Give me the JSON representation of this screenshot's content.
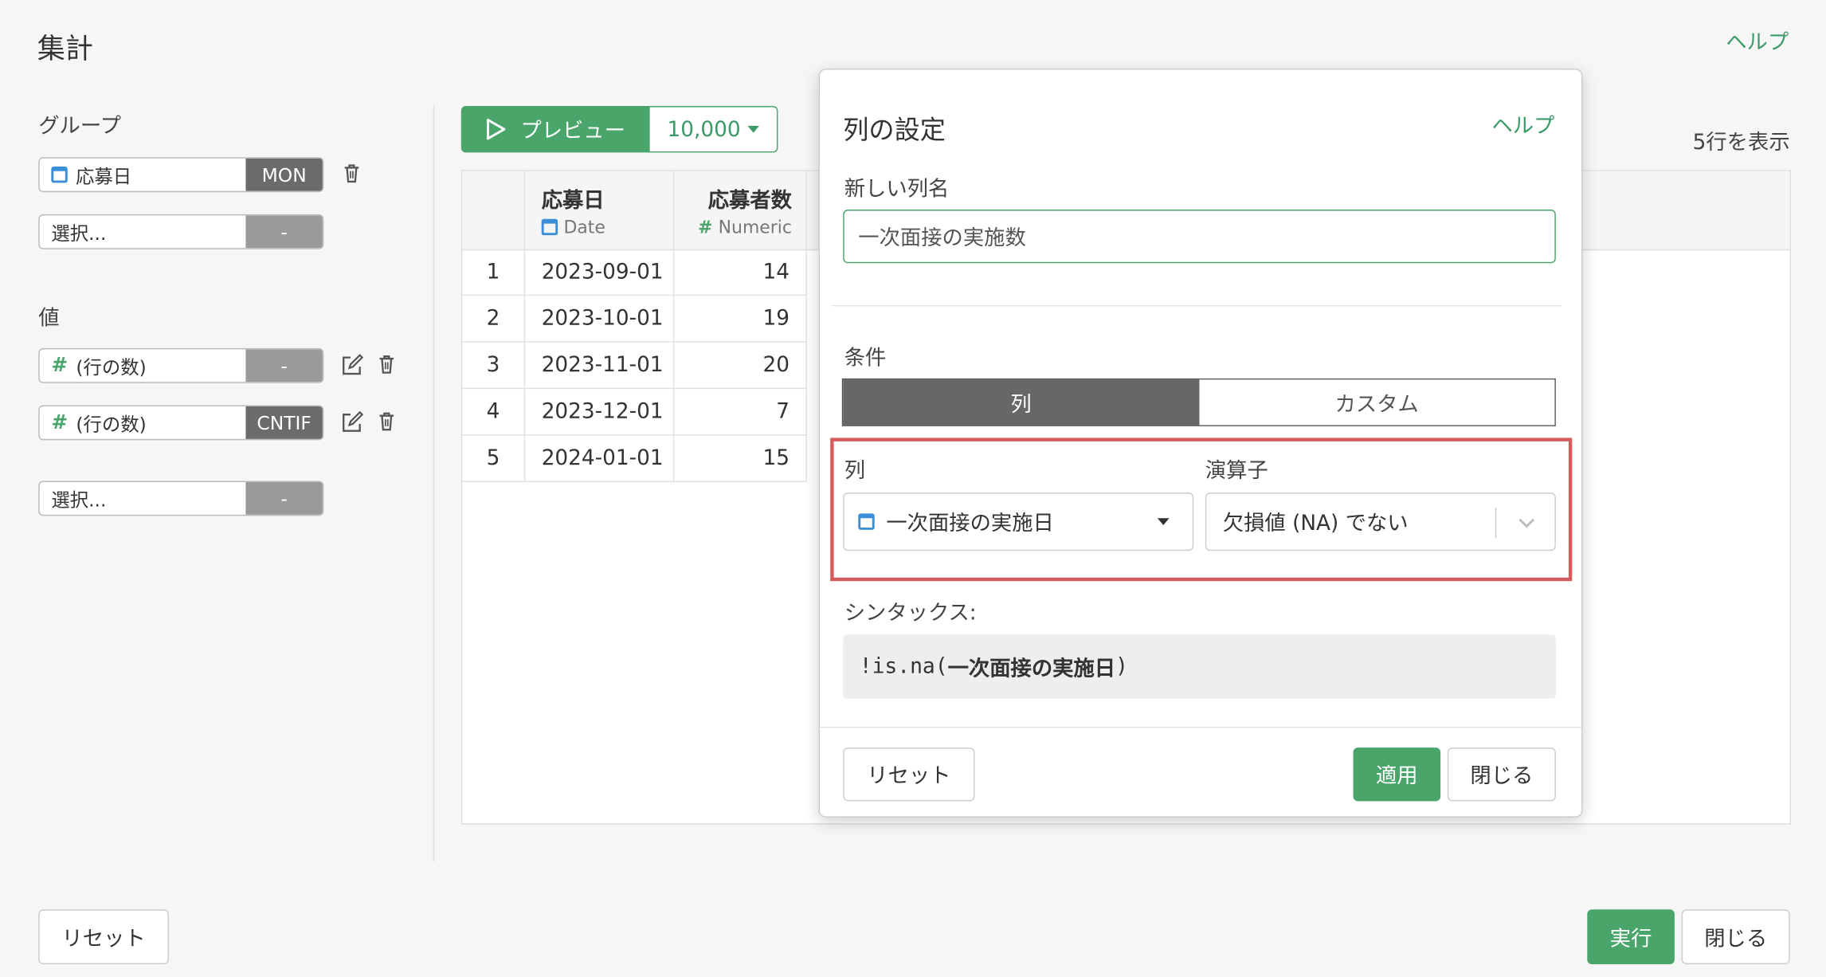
{
  "page": {
    "title": "集計",
    "help": "ヘルプ"
  },
  "group": {
    "label": "グループ",
    "fields": [
      {
        "name": "応募日",
        "type_icon": "calendar-icon",
        "func": "MON"
      },
      {
        "name": "選択...",
        "func": "-"
      }
    ]
  },
  "values": {
    "label": "値",
    "fields": [
      {
        "hash": "#",
        "name": "(行の数)",
        "func": "-"
      },
      {
        "hash": "#",
        "name": "(行の数)",
        "func": "CNTIF"
      },
      {
        "name": "選択...",
        "func": "-"
      }
    ]
  },
  "toolbar": {
    "preview_label": "プレビュー",
    "row_limit": "10,000",
    "row_count_text": "5行を表示"
  },
  "table": {
    "columns": [
      {
        "name": "応募日",
        "type": "Date",
        "type_icon": "calendar-icon"
      },
      {
        "name": "応募者数",
        "type": "Numeric",
        "type_icon": "hash-icon",
        "type_symbol": "#"
      }
    ],
    "rows": [
      {
        "idx": "1",
        "date": "2023-09-01",
        "count": "14"
      },
      {
        "idx": "2",
        "date": "2023-10-01",
        "count": "19"
      },
      {
        "idx": "3",
        "date": "2023-11-01",
        "count": "20"
      },
      {
        "idx": "4",
        "date": "2023-12-01",
        "count": "7"
      },
      {
        "idx": "5",
        "date": "2024-01-01",
        "count": "15"
      }
    ]
  },
  "dialog": {
    "title": "列の設定",
    "help": "ヘルプ",
    "new_name_label": "新しい列名",
    "new_name_value": "一次面接の実施数",
    "condition_label": "条件",
    "tabs": [
      "列",
      "カスタム"
    ],
    "column_label": "列",
    "column_value": "一次面接の実施日",
    "operator_label": "演算子",
    "operator_value": "欠損値 (NA) でない",
    "syntax_label": "シンタックス:",
    "syntax_prefix": "!is.na(",
    "syntax_column": "一次面接の実施日",
    "syntax_suffix": ")",
    "reset": "リセット",
    "apply": "適用",
    "close": "閉じる"
  },
  "footer": {
    "reset": "リセット",
    "run": "実行",
    "close": "閉じる"
  },
  "colors": {
    "accent": "#4aa56b",
    "highlight": "#d65a5a",
    "dark_segment": "#676767"
  }
}
